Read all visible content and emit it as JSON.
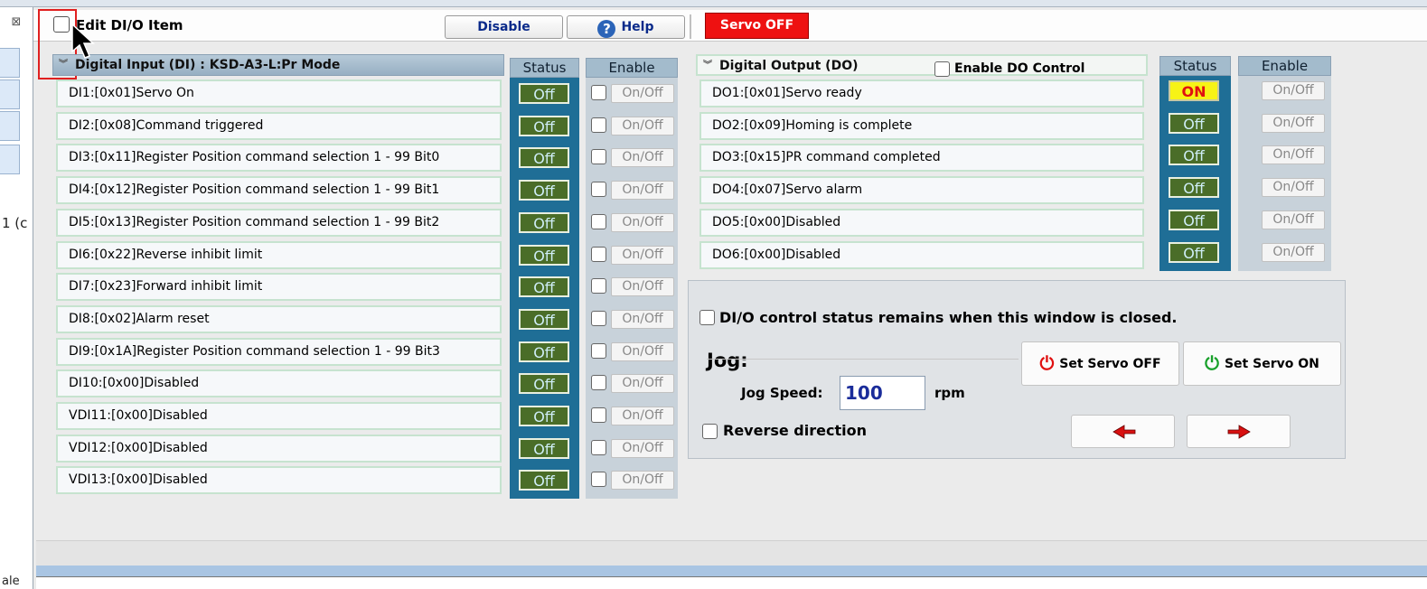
{
  "toolbar": {
    "edit_label": "Edit DI/O Item",
    "disable_label": "Disable",
    "help_label": "Help",
    "servo_status": "Servo OFF"
  },
  "di_panel": {
    "title": "Digital Input (DI) : KSD-A3-L:Pr Mode",
    "status_header": "Status",
    "enable_header": "Enable",
    "rows": [
      {
        "label": "DI1:[0x01]Servo On",
        "status": "Off",
        "enable": "On/Off"
      },
      {
        "label": "DI2:[0x08]Command triggered",
        "status": "Off",
        "enable": "On/Off"
      },
      {
        "label": "DI3:[0x11]Register Position command selection 1 - 99 Bit0",
        "status": "Off",
        "enable": "On/Off"
      },
      {
        "label": "DI4:[0x12]Register Position command selection 1 - 99 Bit1",
        "status": "Off",
        "enable": "On/Off"
      },
      {
        "label": "DI5:[0x13]Register Position command selection 1 - 99 Bit2",
        "status": "Off",
        "enable": "On/Off"
      },
      {
        "label": "DI6:[0x22]Reverse inhibit limit",
        "status": "Off",
        "enable": "On/Off"
      },
      {
        "label": "DI7:[0x23]Forward inhibit limit",
        "status": "Off",
        "enable": "On/Off"
      },
      {
        "label": "DI8:[0x02]Alarm reset",
        "status": "Off",
        "enable": "On/Off"
      },
      {
        "label": "DI9:[0x1A]Register Position command selection 1 - 99 Bit3",
        "status": "Off",
        "enable": "On/Off"
      },
      {
        "label": "DI10:[0x00]Disabled",
        "status": "Off",
        "enable": "On/Off"
      },
      {
        "label": "VDI11:[0x00]Disabled",
        "status": "Off",
        "enable": "On/Off"
      },
      {
        "label": "VDI12:[0x00]Disabled",
        "status": "Off",
        "enable": "On/Off"
      },
      {
        "label": "VDI13:[0x00]Disabled",
        "status": "Off",
        "enable": "On/Off"
      }
    ]
  },
  "do_panel": {
    "title": "Digital Output (DO)",
    "enable_control_label": "Enable DO Control",
    "status_header": "Status",
    "enable_header": "Enable",
    "rows": [
      {
        "label": "DO1:[0x01]Servo ready",
        "status": "ON",
        "enable": "On/Off"
      },
      {
        "label": "DO2:[0x09]Homing is complete",
        "status": "Off",
        "enable": "On/Off"
      },
      {
        "label": "DO3:[0x15]PR command completed",
        "status": "Off",
        "enable": "On/Off"
      },
      {
        "label": "DO4:[0x07]Servo alarm",
        "status": "Off",
        "enable": "On/Off"
      },
      {
        "label": "DO5:[0x00]Disabled",
        "status": "Off",
        "enable": "On/Off"
      },
      {
        "label": "DO6:[0x00]Disabled",
        "status": "Off",
        "enable": "On/Off"
      }
    ]
  },
  "jog": {
    "remain_label": "DI/O control status remains when this window is closed.",
    "title": "Jog:",
    "speed_label": "Jog Speed:",
    "speed_value": "100",
    "speed_unit": "rpm",
    "reverse_label": "Reverse direction",
    "set_servo_off_label": "Set Servo OFF",
    "set_servo_on_label": "Set Servo ON"
  },
  "side": {
    "fragment_text": "1 (c",
    "fragment_text2": "ale"
  },
  "colors": {
    "servo_off_bg": "#ee1111",
    "status_col_bg": "#1f6e96",
    "off_badge_bg": "#4a6d28",
    "on_badge_bg": "#f7f316",
    "highlight": "#e02020"
  }
}
